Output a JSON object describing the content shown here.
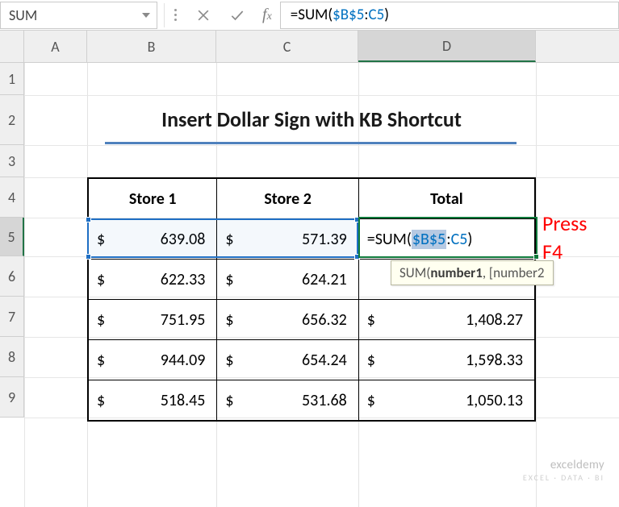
{
  "formula_bar": {
    "name_box_value": "SUM",
    "formula_text": "=SUM($B$5:C5)",
    "formula_prefix": "=SUM(",
    "ref1": "$B$5",
    "separator": ":",
    "ref2": "C5",
    "formula_suffix": ")"
  },
  "columns": {
    "A": "A",
    "B": "B",
    "C": "C",
    "D": "D"
  },
  "rows": [
    "1",
    "2",
    "3",
    "4",
    "5",
    "6",
    "7",
    "8",
    "9"
  ],
  "title": "Insert Dollar Sign with KB Shortcut",
  "tbl": {
    "headers": {
      "b": "Store 1",
      "c": "Store 2",
      "d": "Total"
    },
    "rows": [
      {
        "b": "639.08",
        "c": "571.39",
        "d_formula": {
          "prefix": "=SUM(",
          "ref1": "$B$5",
          "sep": ":",
          "ref2": "C5",
          "suffix": ")"
        }
      },
      {
        "b": "622.33",
        "c": "624.21",
        "d": ""
      },
      {
        "b": "751.95",
        "c": "656.32",
        "d": "1,408.27"
      },
      {
        "b": "944.09",
        "c": "654.24",
        "d": "1,598.33"
      },
      {
        "b": "518.45",
        "c": "531.68",
        "d": "1,050.13"
      }
    ]
  },
  "currency_symbol": "$",
  "tooltip": {
    "fn": "SUM(",
    "arg1": "number1",
    "rest": ", [number2"
  },
  "annotation": {
    "line1": "Press",
    "line2": "F4"
  },
  "watermark": {
    "main": "exceldemy",
    "sub": "EXCEL · DATA · BI"
  },
  "colors": {
    "accent_green": "#217346",
    "range_blue": "#1f6fc4",
    "title_underline": "#4f81bd",
    "annotation_red": "#ff0000"
  },
  "active_cell": "D5",
  "selected_range": "B5:C5"
}
